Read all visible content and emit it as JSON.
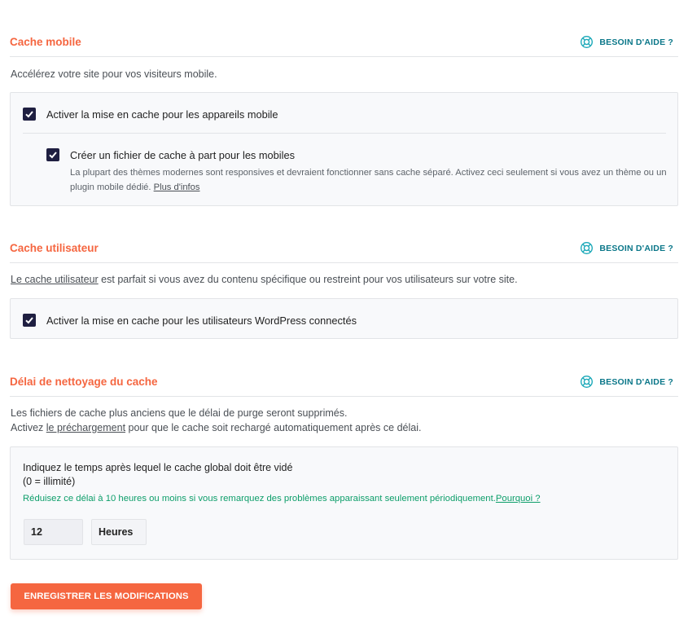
{
  "help_label": "BESOIN D'AIDE ?",
  "mobile": {
    "title": "Cache mobile",
    "description": "Accélérez votre site pour vos visiteurs mobile.",
    "option_main": {
      "label": "Activer la mise en cache pour les appareils mobile",
      "checked": true
    },
    "option_separate": {
      "label": "Créer un fichier de cache à part pour les mobiles",
      "checked": true,
      "note": "La plupart des thèmes modernes sont responsives et devraient fonctionner sans cache séparé. Activez ceci seulement si vous avez un thème ou un plugin mobile dédié.",
      "more_link": "Plus d'infos"
    }
  },
  "user": {
    "title": "Cache utilisateur",
    "description_link": "Le cache utilisateur",
    "description_rest": " est parfait si vous avez du contenu spécifique ou restreint pour vos utilisateurs sur votre site.",
    "option": {
      "label": "Activer la mise en cache pour les utilisateurs WordPress connectés",
      "checked": true
    }
  },
  "purge": {
    "title": "Délai de nettoyage du cache",
    "description_line1": "Les fichiers de cache plus anciens que le délai de purge seront supprimés.",
    "description_line2_pre": "Activez ",
    "description_line2_link": "le préchargement",
    "description_line2_post": " pour que le cache soit rechargé automatiquement après ce délai.",
    "field_label": "Indiquez le temps après lequel le cache global doit être vidé",
    "field_hint": "(0 = illimité)",
    "tip": "Réduisez ce délai à 10 heures ou moins si vous remarquez des problèmes apparaissant seulement périodiquement.",
    "tip_link": "Pourquoi ?",
    "value": "12",
    "unit": "Heures"
  },
  "save_label": "ENREGISTRER LES MODIFICATIONS",
  "colors": {
    "accent": "#f56640",
    "help": "#0b7789",
    "checkbox": "#1f1f41",
    "tip": "#0d9e6a"
  }
}
